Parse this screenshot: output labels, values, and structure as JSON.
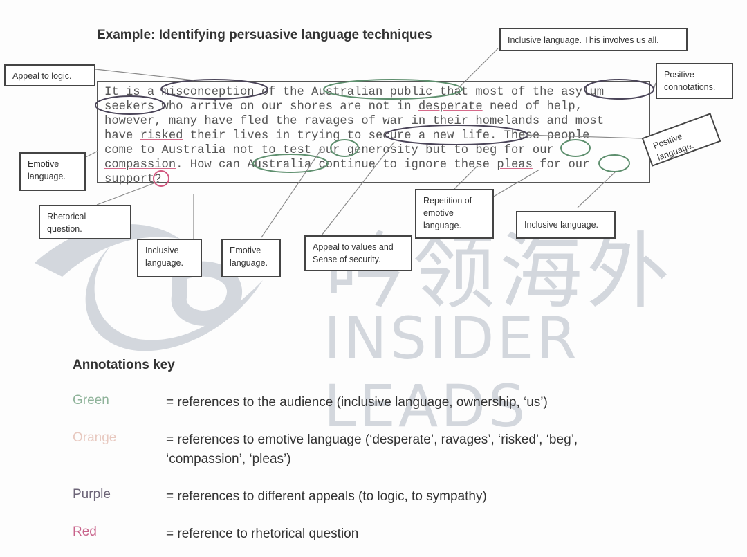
{
  "title": "Example: Identifying persuasive language techniques",
  "watermark": {
    "chinese": "吟领海外",
    "english": "INSIDER LEADS"
  },
  "passage": {
    "lines": [
      [
        "It is a ",
        "misconception",
        " of the ",
        "Australian public",
        " that most of the ",
        "asylum"
      ],
      [
        "seekers",
        " who arrive on our shores are not in ",
        "desperate",
        " need of help,"
      ],
      [
        "however, many have fled the ",
        "ravages",
        " of war in their homelands and most"
      ],
      [
        "have ",
        "risked",
        " their lives in trying to ",
        "secure a new life",
        ". These people"
      ],
      [
        "come to Australia not to test ",
        "our",
        " generosity but to ",
        "beg",
        " for ",
        "our"
      ],
      [
        "compassion",
        ". How can ",
        "Australia",
        " continue to ignore these ",
        "pleas",
        " for ",
        "our"
      ],
      [
        "support",
        "?"
      ]
    ]
  },
  "callouts": {
    "appeal_logic": "Appeal to logic.",
    "inclusive_all": "Inclusive language. This involves us all.",
    "positive_connotations": "Positive connotations.",
    "positive_language": "Positive language.",
    "emotive_left": "Emotive language.",
    "rhetorical": "Rhetorical question.",
    "inclusive_1": "Inclusive language.",
    "emotive_2": "Emotive language.",
    "appeal_values": "Appeal to values and Sense of security.",
    "repetition": "Repetition of emotive language.",
    "inclusive_2": "Inclusive language."
  },
  "key": {
    "heading": "Annotations key",
    "items": [
      {
        "name": "Green",
        "color": "#8fb39a",
        "desc": "= references to the audience (inclusive language, ownership, ‘us’)"
      },
      {
        "name": "Orange",
        "color": "#e8c9c0",
        "desc": "= references to emotive language (‘desperate’, ravages’, ‘risked’, ‘beg’,",
        "desc2": "‘compassion’, ‘pleas’)"
      },
      {
        "name": "Purple",
        "color": "#6d6578",
        "desc": "= references to different appeals (to logic, to sympathy)"
      },
      {
        "name": "Red",
        "color": "#c8628a",
        "desc": "= reference to rhetorical question"
      }
    ]
  },
  "colors": {
    "green": "#5e8f6e",
    "purple": "#4a4458",
    "red": "#d2577f",
    "orange_underline": "#d56a8a"
  }
}
